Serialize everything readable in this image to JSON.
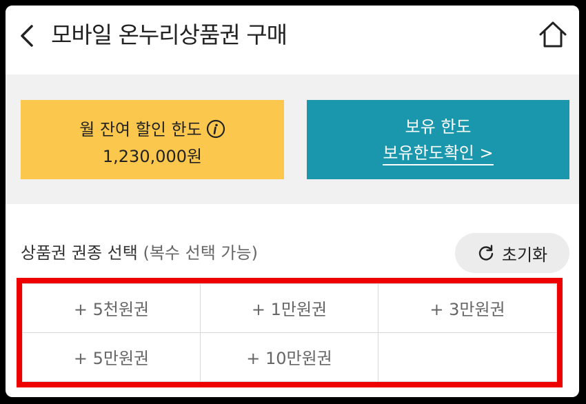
{
  "header": {
    "title": "모바일 온누리상품권 구매",
    "back_icon": "chevron-left-icon",
    "home_icon": "home-icon"
  },
  "limit_card": {
    "label": "월 잔여 할인 한도",
    "amount": "1,230,000원",
    "icon": "info-icon",
    "color": "#fcc74d"
  },
  "hold_card": {
    "label": "보유 한도",
    "link": "보유한도확인 >",
    "color": "#1a97ad"
  },
  "voucher_section": {
    "label": "상품권 권종 선택",
    "sub_label": "(복수 선택 가능)",
    "reset_label": "초기화",
    "reset_icon": "refresh-icon",
    "options": [
      "+ 5천원권",
      "+ 1만원권",
      "+ 3만원권",
      "+ 5만원권",
      "+ 10만원권",
      ""
    ],
    "highlight_color": "#ee0000"
  }
}
